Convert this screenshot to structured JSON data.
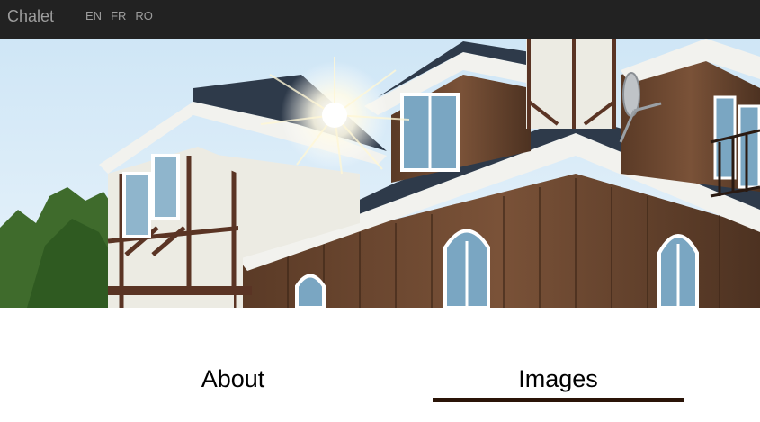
{
  "navbar": {
    "brand": "Chalet",
    "languages": [
      {
        "code": "EN"
      },
      {
        "code": "FR"
      },
      {
        "code": "RO"
      }
    ],
    "background": "#222222",
    "text_color": "#9d9d9d"
  },
  "hero": {
    "image_subject": "chalet-house-photo"
  },
  "tabs": {
    "items": [
      {
        "label": "About",
        "active": false
      },
      {
        "label": "Images",
        "active": true
      }
    ],
    "active_underline_color": "#2a1408"
  }
}
